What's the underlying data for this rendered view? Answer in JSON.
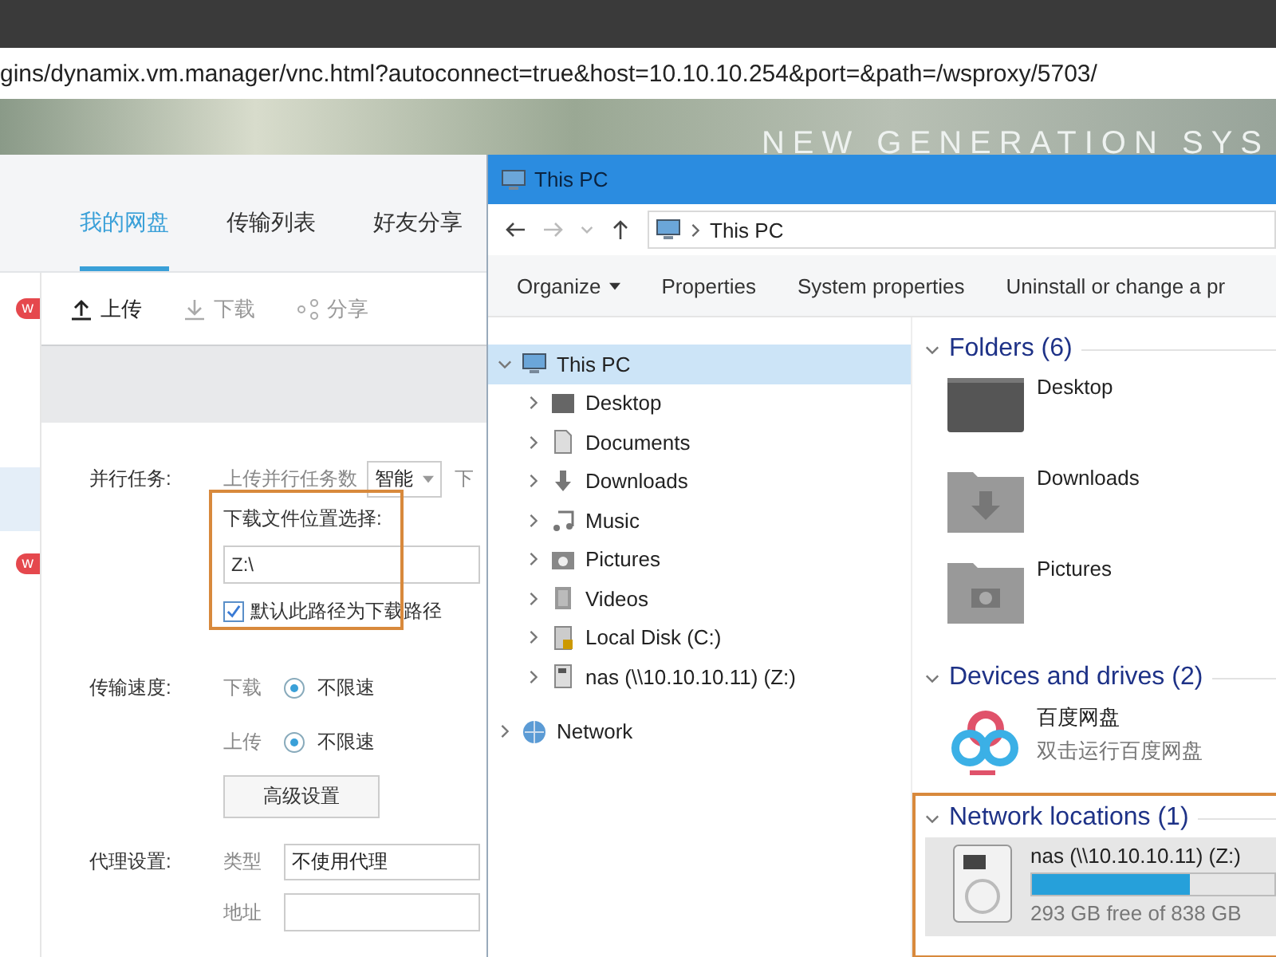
{
  "browser": {
    "url": "gins/dynamix.vm.manager/vnc.html?autoconnect=true&host=10.10.10.254&port=&path=/wsproxy/5703/",
    "banner_text": "NEW GENERATION SYS"
  },
  "baidu": {
    "tabs": [
      {
        "label": "我的网盘",
        "selected": true
      },
      {
        "label": "传输列表",
        "selected": false
      },
      {
        "label": "好友分享",
        "selected": false
      }
    ],
    "sidebar_items": [
      {
        "badge": "w",
        "selected": false
      },
      {
        "selected": false
      },
      {
        "selected": false
      },
      {
        "selected": true
      },
      {
        "badge": "w",
        "selected": false
      }
    ],
    "toolbar": [
      {
        "label": "上传",
        "kind": "upload",
        "disabled": false
      },
      {
        "label": "下载",
        "kind": "download",
        "disabled": true
      },
      {
        "label": "分享",
        "kind": "share",
        "disabled": true
      }
    ],
    "settings": {
      "parallel": {
        "label": "并行任务:",
        "sub_label": "上传并行任务数",
        "value": "智能",
        "cut_label": "下"
      },
      "location": {
        "label": "下载文件位置选择:",
        "value": "Z:\\",
        "default_checked": true,
        "default_label": "默认此路径为下载路径",
        "highlighted": true
      },
      "speed": {
        "label": "传输速度:",
        "rows": [
          {
            "label": "下载",
            "option": "不限速",
            "selected": true
          },
          {
            "label": "上传",
            "option": "不限速",
            "selected": true
          }
        ],
        "button": "高级设置"
      },
      "proxy": {
        "label": "代理设置:",
        "type_label": "类型",
        "type_value": "不使用代理",
        "address_label": "地址"
      }
    }
  },
  "explorer": {
    "title": "This PC",
    "address": "This PC",
    "commands": [
      {
        "label": "Organize",
        "menu": true
      },
      {
        "label": "Properties",
        "menu": false
      },
      {
        "label": "System properties",
        "menu": false
      },
      {
        "label": "Uninstall or change a pr",
        "menu": false
      }
    ],
    "tree": [
      {
        "label": "This PC",
        "kind": "pc",
        "expanded": true,
        "selected": true,
        "children": [
          {
            "label": "Desktop",
            "kind": "desktop",
            "expanded": false,
            "selected": false
          },
          {
            "label": "Documents",
            "kind": "documents",
            "expanded": false,
            "selected": false
          },
          {
            "label": "Downloads",
            "kind": "downloads",
            "expanded": false,
            "selected": false
          },
          {
            "label": "Music",
            "kind": "music",
            "expanded": false,
            "selected": false
          },
          {
            "label": "Pictures",
            "kind": "pictures",
            "expanded": false,
            "selected": false
          },
          {
            "label": "Videos",
            "kind": "videos",
            "expanded": false,
            "selected": false
          },
          {
            "label": "Local Disk (C:)",
            "kind": "disk",
            "expanded": false,
            "selected": false
          },
          {
            "label": "nas (\\\\10.10.10.11) (Z:)",
            "kind": "nas",
            "expanded": false,
            "selected": false
          }
        ]
      },
      {
        "label": "Network",
        "kind": "network",
        "expanded": false,
        "selected": false
      }
    ],
    "groups": [
      {
        "title": "Folders (6)",
        "items": [
          {
            "kind": "desktop",
            "name": "Desktop"
          },
          {
            "kind": "downloads",
            "name": "Downloads"
          },
          {
            "kind": "pictures",
            "name": "Pictures"
          }
        ]
      },
      {
        "title": "Devices and drives (2)",
        "items": [
          {
            "kind": "app",
            "name": "百度网盘",
            "detail": "双击运行百度网盘"
          }
        ]
      },
      {
        "title": "Network locations (1)",
        "highlighted": true,
        "items": [
          {
            "kind": "drive",
            "name": "nas (\\\\10.10.10.11) (Z:)",
            "level": 0.65,
            "detail": "293 GB free of 838 GB"
          }
        ]
      }
    ]
  }
}
